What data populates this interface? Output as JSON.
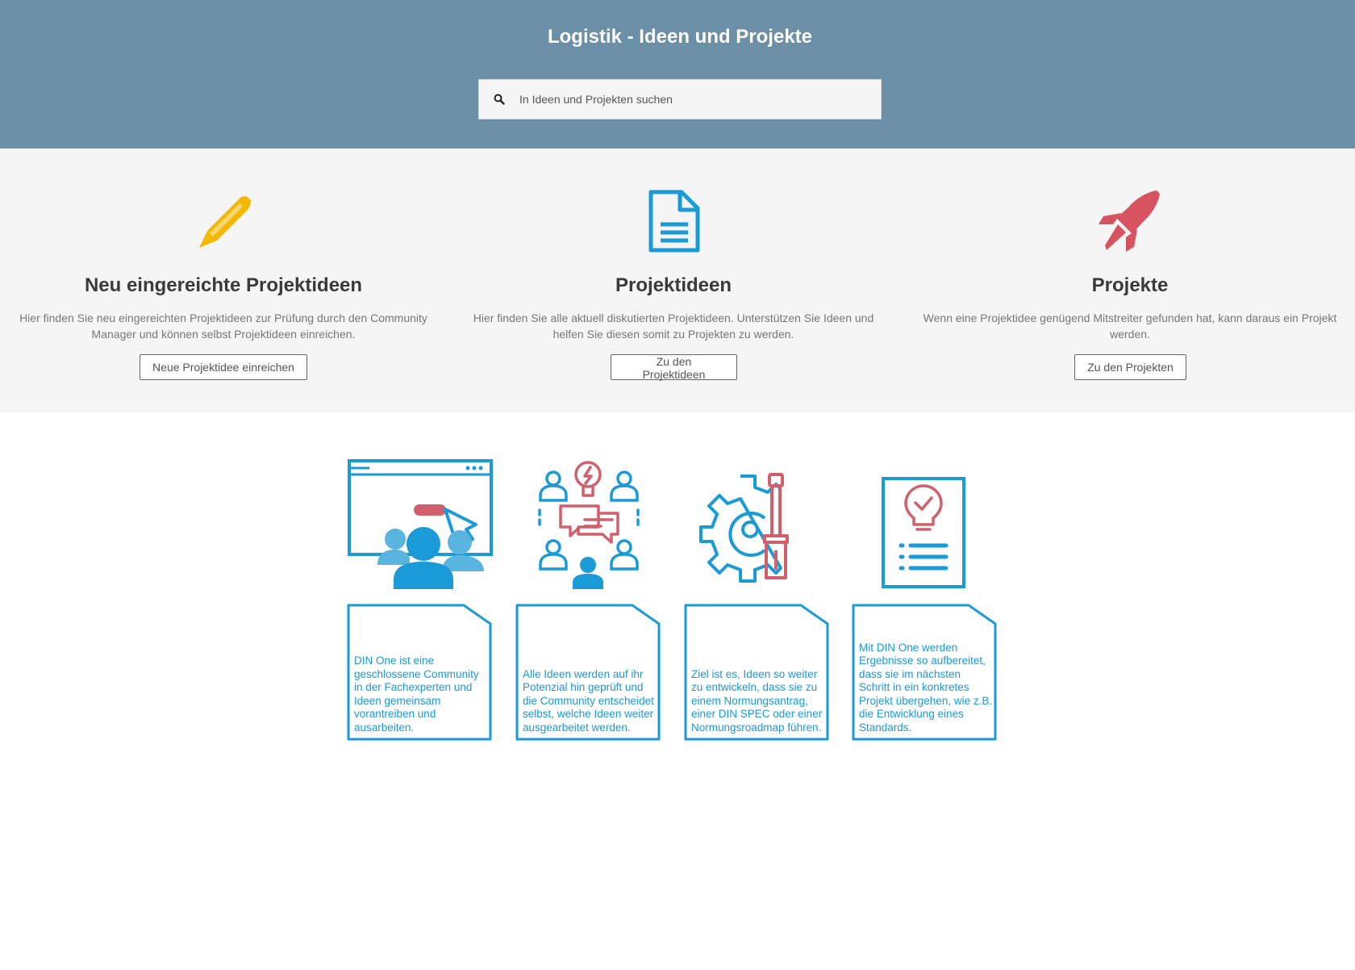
{
  "header": {
    "title": "Logistik - Ideen und Projekte",
    "search_placeholder": "In Ideen und Projekten suchen"
  },
  "columns": [
    {
      "icon": "pencil-icon",
      "title": "Neu eingereichte Projektideen",
      "description": "Hier finden Sie neu eingereichten Projektideen zur Prüfung durch den Community Manager und können selbst Projektideen einreichen.",
      "button": "Neue Projektidee einreichen",
      "color": "#f5b800"
    },
    {
      "icon": "document-icon",
      "title": "Projektideen",
      "description": "Hier finden Sie alle aktuell diskutierten Projektideen. Unterstützen Sie Ideen und helfen Sie diesen somit zu Projekten zu werden.",
      "button": "Zu den Projektideen",
      "color": "#1a9ad6"
    },
    {
      "icon": "rocket-icon",
      "title": "Projekte",
      "description": "Wenn eine Projektidee genügend Mitstreiter gefunden hat, kann daraus ein Projekt werden.",
      "button": "Zu den Projekten",
      "color": "#d6535f"
    }
  ],
  "steps": [
    {
      "icon": "community-presentation-icon",
      "text": "DIN One ist eine geschlossene Community in der Fachexperten und Ideen gemeinsam vorantreiben und ausarbeiten."
    },
    {
      "icon": "collaboration-ideas-icon",
      "text": "Alle Ideen werden auf ihr Potenzial hin geprüft und die Community entscheidet selbst, welche Ideen weiter ausgearbeitet werden."
    },
    {
      "icon": "gear-screwdriver-icon",
      "text": "Ziel ist es, Ideen so weiter zu entwickeln, dass sie zu einem Normungsantrag, einer DIN SPEC oder einer Normungsroadmap führen."
    },
    {
      "icon": "idea-document-icon",
      "text": "Mit DIN One werden Ergebnisse so aufbereitet, dass sie im nächsten Schritt in ein konkretes Projekt übergehen, wie z.B. die Entwicklung eines Standards."
    }
  ],
  "colors": {
    "header_bg": "#6b8fa6",
    "band_bg": "#f5f5f5",
    "blue": "#1a9ad6",
    "red": "#d0616c"
  }
}
